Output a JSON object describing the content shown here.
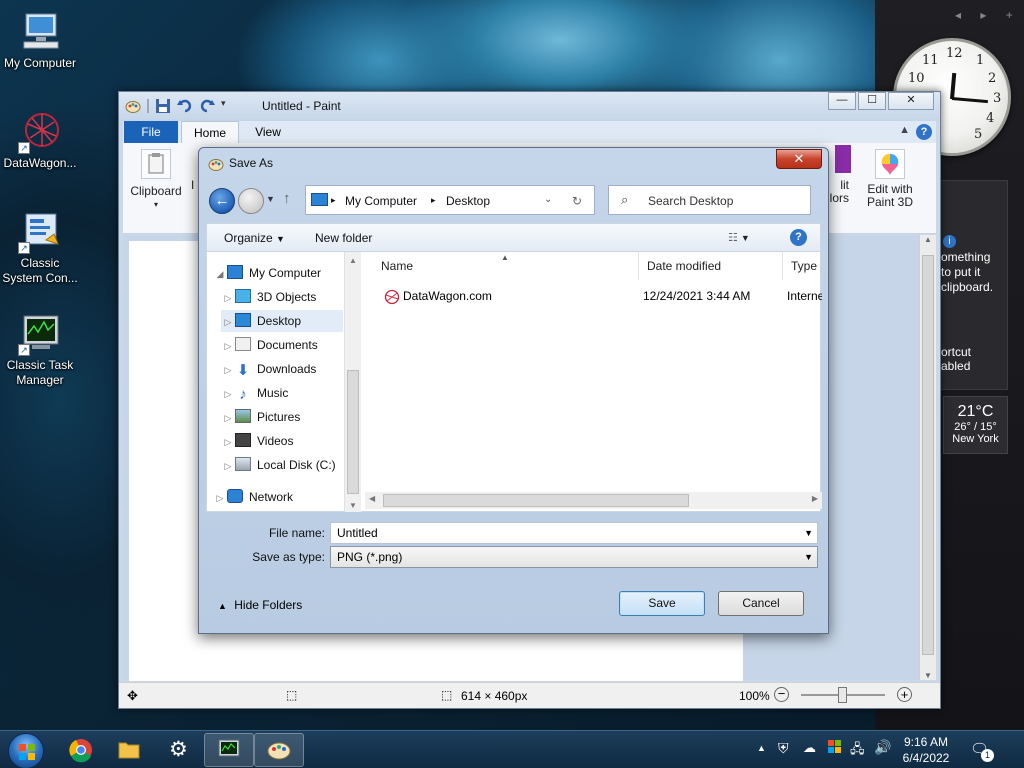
{
  "desktop": {
    "icons": [
      {
        "label": "My Computer"
      },
      {
        "label": "DataWagon..."
      },
      {
        "label": "Classic System Con..."
      },
      {
        "label": "Classic Task Manager"
      }
    ]
  },
  "gadgets": {
    "clock_numbers": [
      "12",
      "1",
      "2",
      "3",
      "4",
      "5",
      "10",
      "11"
    ],
    "notice_lines": [
      "omething",
      "to put it",
      "clipboard.",
      "ortcut",
      "abled"
    ],
    "weather": {
      "temp": "21°C",
      "range": "26° / 15°",
      "city": "New York"
    }
  },
  "paint": {
    "title": "Untitled - Paint",
    "window_buttons": {
      "minimize": "—",
      "maximize": "☐",
      "close": "✕"
    },
    "tabs": [
      {
        "label": "File"
      },
      {
        "label": "Home"
      },
      {
        "label": "View"
      }
    ],
    "ribbon": {
      "clipboard": "Clipboard",
      "clipboard_cut": "I",
      "colors_partial_1": "lit",
      "colors_partial_2": "lors",
      "edit_with_paint3d_1": "Edit with",
      "edit_with_paint3d_2": "Paint 3D"
    },
    "status": {
      "dimensions": "614 × 460px",
      "zoom": "100%"
    }
  },
  "dialog": {
    "title": "Save As",
    "close": "✕",
    "address": {
      "segments": [
        "My Computer",
        "Desktop"
      ]
    },
    "search_placeholder": "Search Desktop",
    "toolbar": {
      "organize": "Organize",
      "new_folder": "New folder",
      "help": "?"
    },
    "tree": [
      {
        "label": "My Computer"
      },
      {
        "label": "3D Objects"
      },
      {
        "label": "Desktop"
      },
      {
        "label": "Documents"
      },
      {
        "label": "Downloads"
      },
      {
        "label": "Music"
      },
      {
        "label": "Pictures"
      },
      {
        "label": "Videos"
      },
      {
        "label": "Local Disk (C:)"
      },
      {
        "label": "Network"
      }
    ],
    "columns": {
      "name": "Name",
      "date": "Date modified",
      "type": "Type"
    },
    "files": [
      {
        "name": "DataWagon.com",
        "date": "12/24/2021 3:44 AM",
        "type": "Interne"
      }
    ],
    "file_name_label": "File name:",
    "file_name_value": "Untitled",
    "save_type_label": "Save as type:",
    "save_type_value": "PNG (*.png)",
    "hide_folders": "Hide Folders",
    "save_button": "Save",
    "cancel_button": "Cancel"
  },
  "taskbar": {
    "time": "9:16 AM",
    "date": "6/4/2022",
    "notifications": "1"
  }
}
